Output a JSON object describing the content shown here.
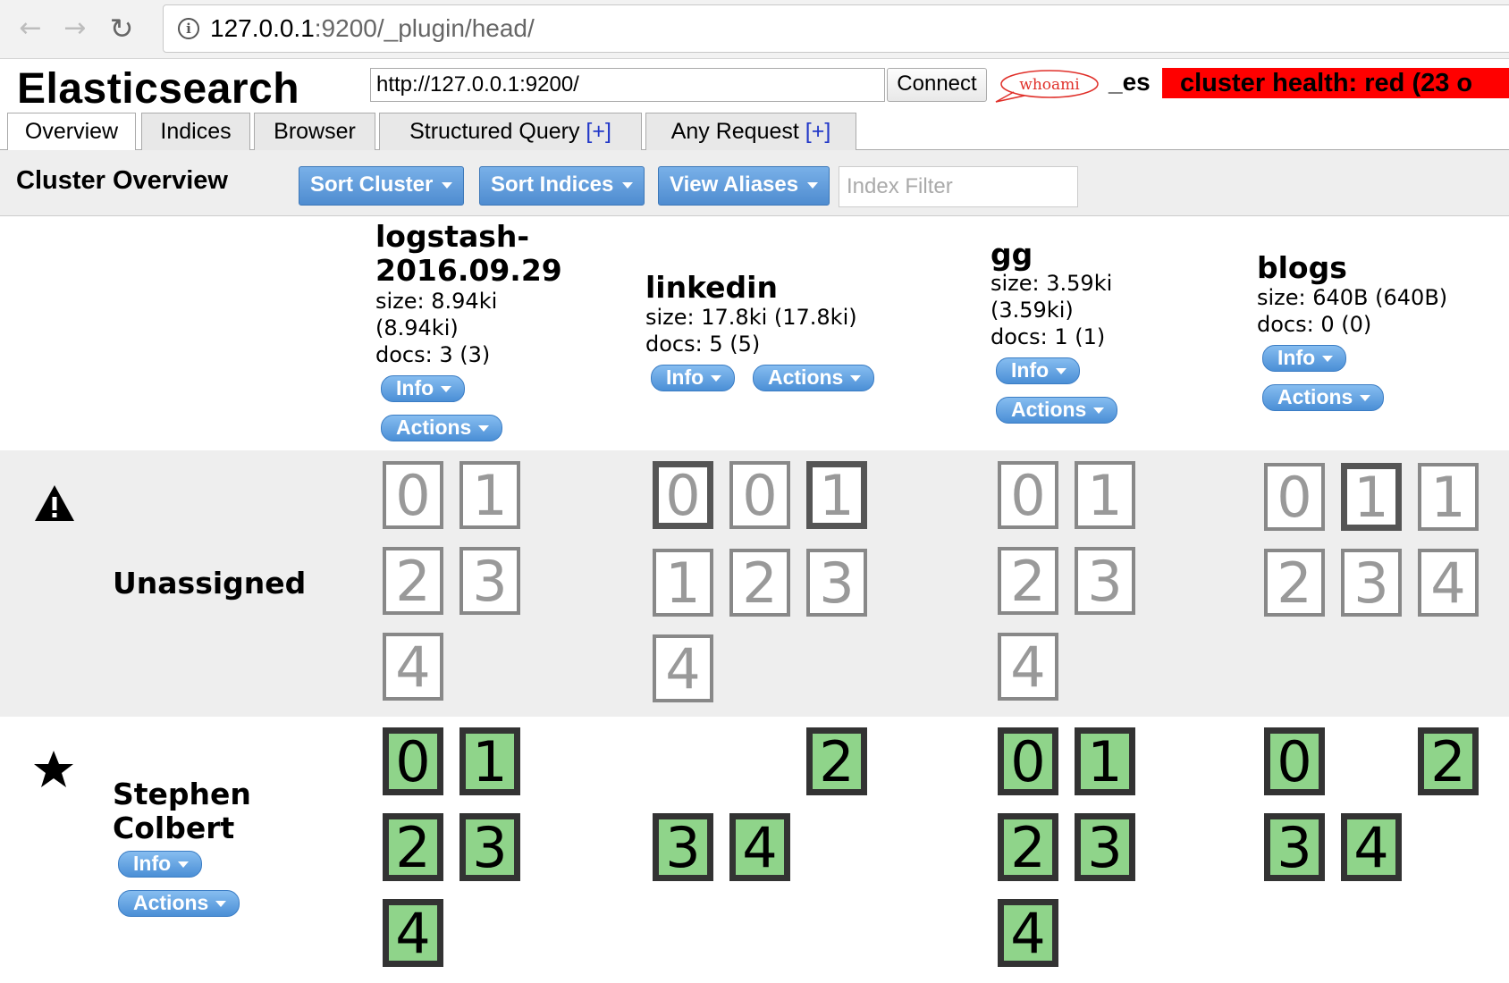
{
  "browser": {
    "url_host": "127.0.0.1",
    "url_rest": ":9200/_plugin/head/",
    "back_icon": "arrow-left-icon",
    "forward_icon": "arrow-right-icon",
    "reload_icon": "reload-icon",
    "info_icon": "info-icon"
  },
  "header": {
    "title": "Elasticsearch",
    "connection_url": "http://127.0.0.1:9200/",
    "connect_label": "Connect",
    "whoami_label": "whoami",
    "cluster_name": "_es",
    "cluster_health": "cluster health: red (23 o"
  },
  "tabs": [
    {
      "label": "Overview",
      "plus": ""
    },
    {
      "label": "Indices",
      "plus": ""
    },
    {
      "label": "Browser",
      "plus": ""
    },
    {
      "label": "Structured Query ",
      "plus": "[+]"
    },
    {
      "label": "Any Request ",
      "plus": "[+]"
    }
  ],
  "toolbar": {
    "title": "Cluster Overview",
    "sort_cluster": "Sort Cluster",
    "sort_indices": "Sort Indices",
    "view_aliases": "View Aliases",
    "filter_placeholder": "Index Filter"
  },
  "buttons": {
    "info": "Info",
    "actions": "Actions"
  },
  "indices": [
    {
      "name_line1": "logstash-",
      "name_line2": "2016.09.29",
      "size_line1": "size: 8.94ki",
      "size_line2": "(8.94ki)",
      "docs": "docs: 3 (3)"
    },
    {
      "name": "linkedin",
      "size": "size: 17.8ki (17.8ki)",
      "docs": "docs: 5 (5)"
    },
    {
      "name": "gg",
      "size_line1": "size: 3.59ki",
      "size_line2": "(3.59ki)",
      "docs": "docs: 1 (1)"
    },
    {
      "name": "blogs",
      "size": "size: 640B (640B)",
      "docs": "docs: 0 (0)"
    }
  ],
  "rows": {
    "unassigned": {
      "label": "Unassigned",
      "icon": "warning-icon"
    },
    "node": {
      "label_line1": "Stephen",
      "label_line2": "Colbert",
      "icon": "star-icon"
    }
  },
  "shards": {
    "unassigned": {
      "logstash": [
        "0",
        "1",
        "2",
        "3",
        "4"
      ],
      "linkedin": [
        "0",
        "0",
        "1",
        "1",
        "2",
        "3",
        "4"
      ],
      "gg": [
        "0",
        "1",
        "2",
        "3",
        "4"
      ],
      "blogs": [
        "0",
        "1",
        "1",
        "2",
        "3",
        "4"
      ]
    },
    "assigned": {
      "logstash": [
        "0",
        "1",
        "2",
        "3",
        "4"
      ],
      "linkedin": [
        "2",
        "3",
        "4"
      ],
      "gg": [
        "0",
        "1",
        "2",
        "3",
        "4"
      ],
      "blogs": [
        "0",
        "2",
        "3",
        "4"
      ]
    }
  },
  "colors": {
    "health_red": "#ff0000",
    "shard_started": "#8fd48a",
    "button_blue": "#4f8cd0"
  }
}
